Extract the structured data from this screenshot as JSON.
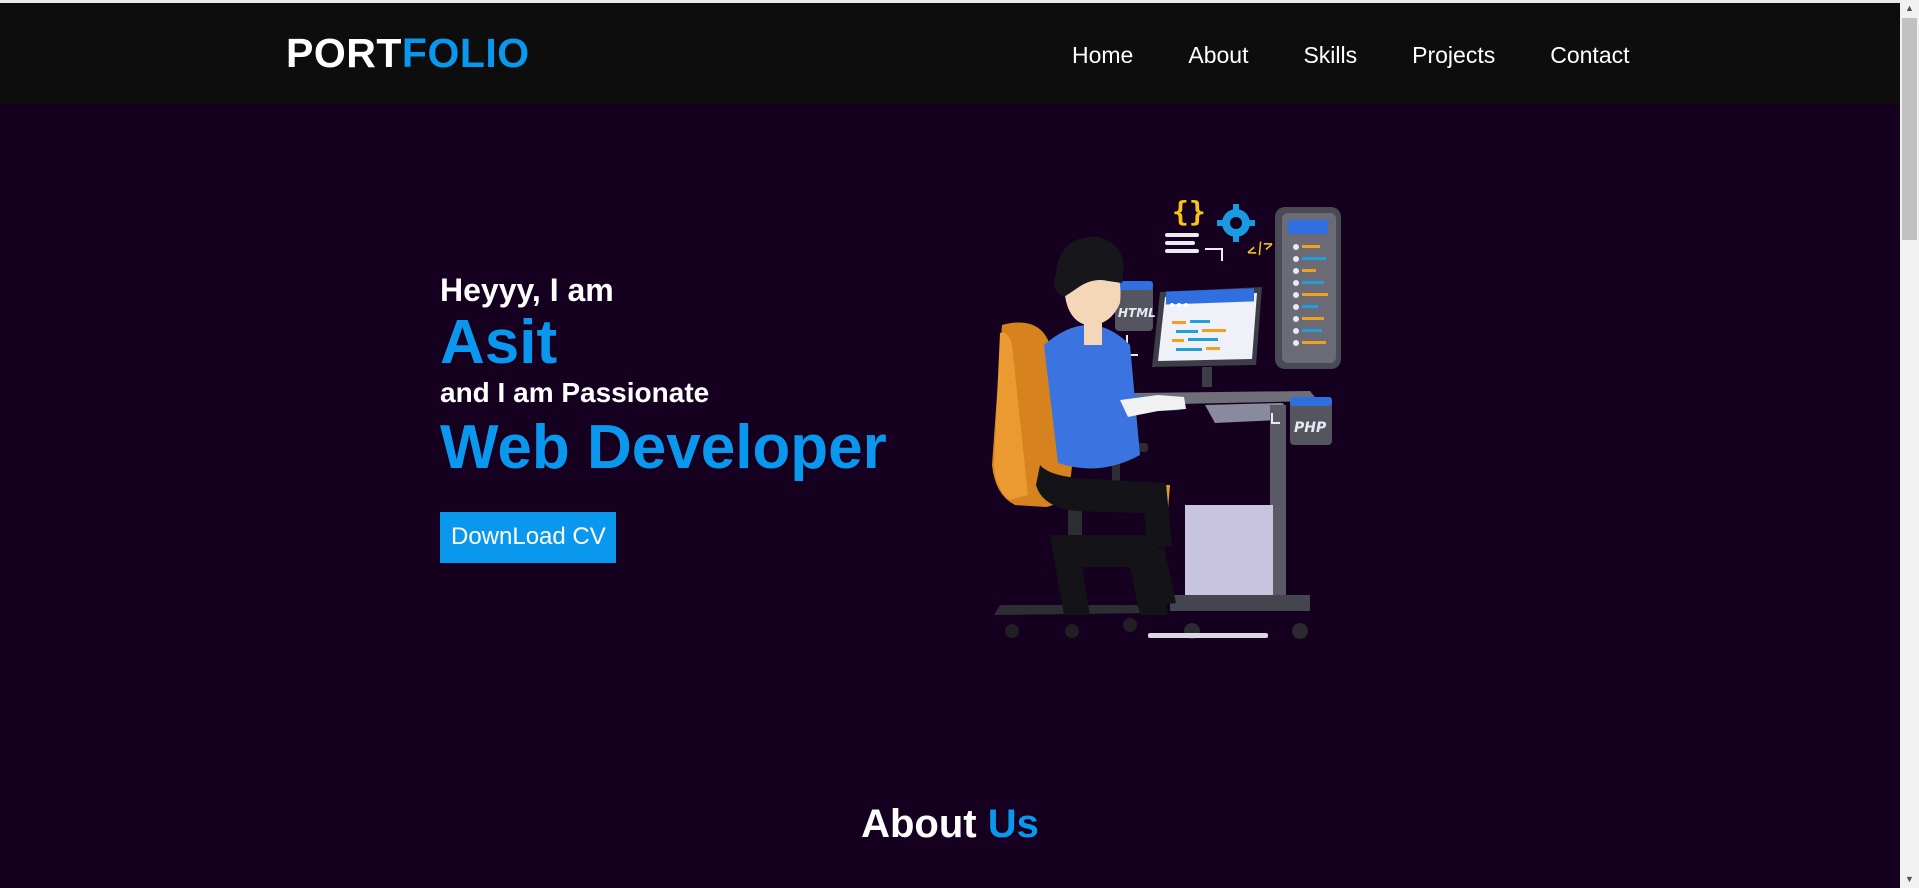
{
  "header": {
    "logo_part1": "PORT",
    "logo_part2": "FOLIO",
    "nav": [
      "Home",
      "About",
      "Skills",
      "Projects",
      "Contact"
    ]
  },
  "hero": {
    "greeting": "Heyyy, I am",
    "name": "Asit",
    "tagline": "and I am Passionate",
    "role": "Web Developer",
    "cta": "DownLoad CV",
    "illustration_labels": {
      "html": "HTML",
      "php": "PHP",
      "braces": "{}",
      "code": "</>"
    }
  },
  "about": {
    "title_part1": "About ",
    "title_part2": "Us"
  },
  "colors": {
    "accent": "#0a98ef",
    "hero_background": "#150020",
    "header_background": "#0d0d0d"
  }
}
